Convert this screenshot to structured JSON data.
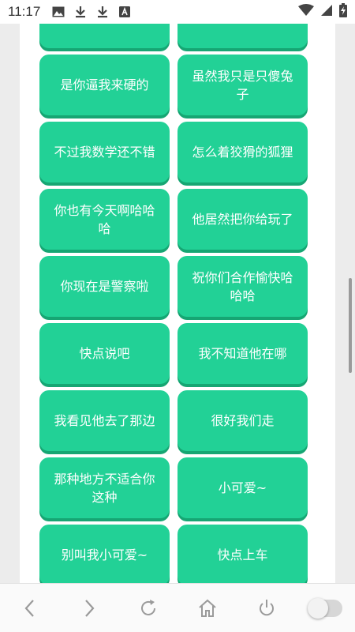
{
  "status_bar": {
    "time": "11:17",
    "left_icons": [
      "image-icon",
      "download-icon",
      "download-icon",
      "a-box-icon"
    ],
    "right_icons": [
      "wifi-icon",
      "signal-icon",
      "battery-charging-icon"
    ]
  },
  "phrases": [
    {
      "left": "",
      "right": ""
    },
    {
      "left": "是你逼我来硬的",
      "right": "虽然我只是只傻兔子"
    },
    {
      "left": "不过我数学还不错",
      "right": "怎么着狡猾的狐狸"
    },
    {
      "left": "你也有今天啊哈哈哈",
      "right": "他居然把你给玩了"
    },
    {
      "left": "你现在是警察啦",
      "right": "祝你们合作愉快哈哈哈"
    },
    {
      "left": "快点说吧",
      "right": "我不知道他在哪"
    },
    {
      "left": "我看见他去了那边",
      "right": "很好我们走"
    },
    {
      "left": "那种地方不适合你这种",
      "right": "小可爱~"
    },
    {
      "left": "别叫我小可爱~",
      "right": "快点上车"
    },
    {
      "left": "",
      "right": ""
    }
  ],
  "colors": {
    "button": "#22d196",
    "button_shadow": "#16a673",
    "text": "#ffffff"
  },
  "nav_bar": {
    "buttons": [
      "back-icon",
      "forward-icon",
      "refresh-icon",
      "home-icon",
      "power-icon",
      "toggle-switch"
    ]
  }
}
